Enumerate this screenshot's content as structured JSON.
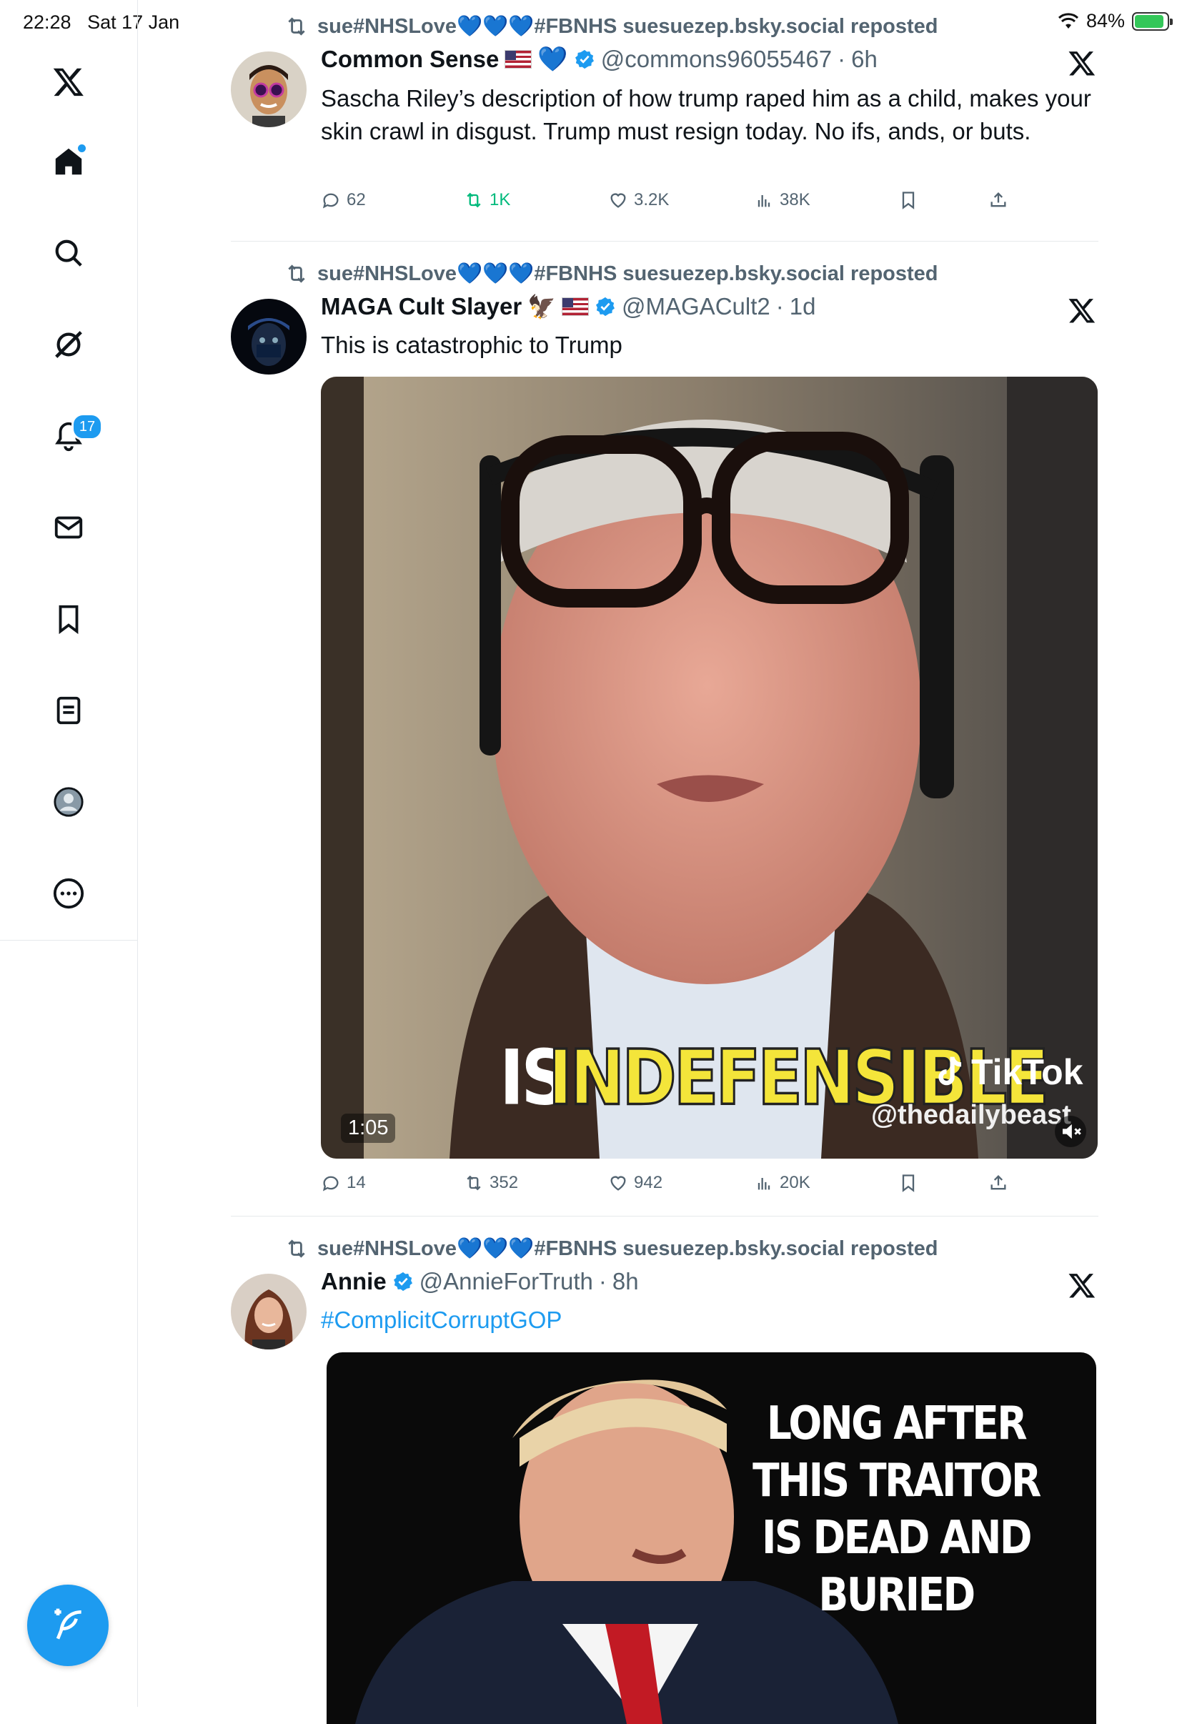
{
  "status_bar": {
    "time": "22:28",
    "date": "Sat 17 Jan",
    "battery": "84%"
  },
  "sidebar": {
    "items": [
      {
        "name": "home",
        "label": "Home"
      },
      {
        "name": "explore",
        "label": "Explore"
      },
      {
        "name": "grok",
        "label": "Grok"
      },
      {
        "name": "notifications",
        "label": "Notifications",
        "badge": "17"
      },
      {
        "name": "messages",
        "label": "Messages"
      },
      {
        "name": "bookmarks",
        "label": "Bookmarks"
      },
      {
        "name": "lists",
        "label": "Lists"
      },
      {
        "name": "profile",
        "label": "Profile"
      },
      {
        "name": "more",
        "label": "More"
      }
    ],
    "compose_label": "Post"
  },
  "tweets": [
    {
      "repost_text": "sue#NHSLove💙💙💙#FBNHS suesuezep.bsky.social reposted",
      "name": "Common Sense",
      "handle": "@commons96055467",
      "sep": "·",
      "time": "6h",
      "text": "Sascha Riley’s description of how trump raped him as a child, makes your skin crawl in disgust. Trump must resign today. No ifs, ands, or buts.",
      "replies": "62",
      "reposts": "1K",
      "likes": "3.2K",
      "views": "38K"
    },
    {
      "repost_text": "sue#NHSLove💙💙💙#FBNHS suesuezep.bsky.social reposted",
      "name": "MAGA Cult Slayer",
      "handle": "@MAGACult2",
      "sep": "·",
      "time": "1d",
      "text": "This is catastrophic to Trump",
      "video": {
        "duration": "1:05",
        "caption_is": "IS",
        "caption_main": "INDEFENSIBLE",
        "tiktok_label": "TikTok",
        "tiktok_handle": "@thedailybeast"
      },
      "replies": "14",
      "reposts": "352",
      "likes": "942",
      "views": "20K"
    },
    {
      "repost_text": "sue#NHSLove💙💙💙#FBNHS suesuezep.bsky.social reposted",
      "name": "Annie",
      "handle": "@AnnieForTruth",
      "sep": "·",
      "time": "8h",
      "text": "#ComplicitCorruptGOP",
      "image_text": "LONG AFTER THIS TRAITOR IS DEAD AND BURIED"
    }
  ],
  "colors": {
    "accent": "#1d9bf0",
    "secondary_text": "#536471",
    "repost_green": "#00ba7c"
  }
}
